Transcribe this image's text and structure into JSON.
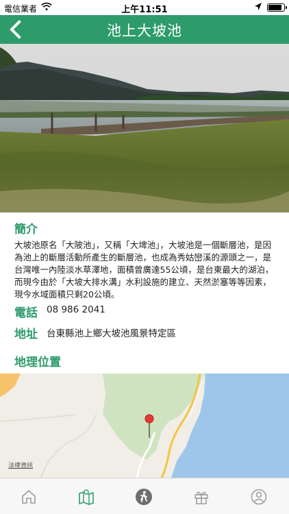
{
  "status_bar": {
    "carrier": "電信業者",
    "time": "上午11:51"
  },
  "header": {
    "title": "池上大坡池"
  },
  "intro": {
    "heading": "簡介",
    "body": "大坡池原名「大陂池」，又稱「大埤池」，大坡池是一個斷層池，是因為池上的斷層活動所產生的斷層池，也成為秀姑巒溪的源頭之一，是台灣唯一內陸淡水草澤地，面積曾廣達55公頃，是台東最大的湖泊，而現今由於「大坡大排水溝」水利設施的建立、天然淤塞等等因素，現今水域面積只剩20公頃。"
  },
  "phone": {
    "label": "電話",
    "value": "08 986 2041"
  },
  "address": {
    "label": "地址",
    "value": "台東縣池上鄉大坡池風景特定區"
  },
  "location": {
    "heading": "地理位置",
    "map_legal": "法律資訊"
  },
  "tab_bar": {
    "tabs": [
      {
        "icon": "home-icon",
        "active": false
      },
      {
        "icon": "map-icon",
        "active": true
      },
      {
        "icon": "walking-icon",
        "active": false
      },
      {
        "icon": "gift-icon",
        "active": false
      },
      {
        "icon": "profile-icon",
        "active": false
      }
    ]
  },
  "colors": {
    "accent": "#2e9b6b",
    "tab_inactive": "#9a9a9a",
    "tab_active": "#2e9b6b"
  }
}
